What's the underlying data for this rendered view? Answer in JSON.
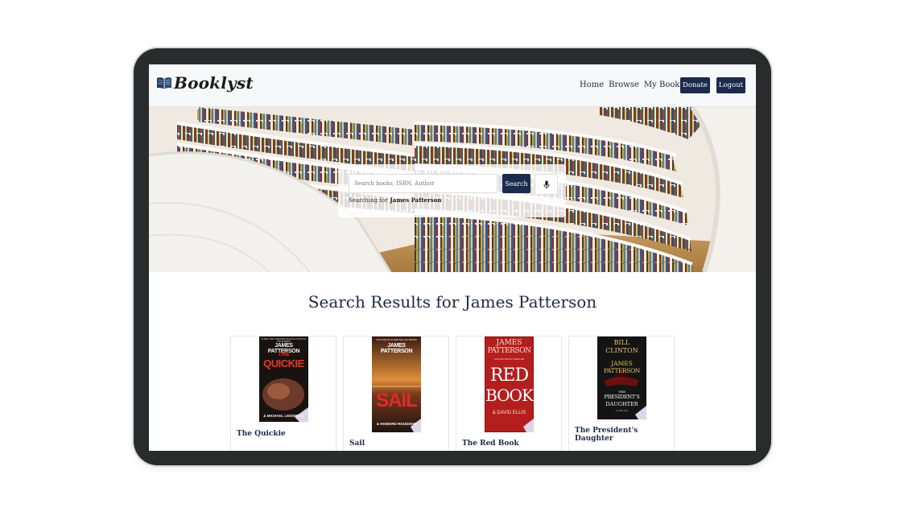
{
  "app": {
    "name": "Booklyst"
  },
  "nav": {
    "links": [
      "Home",
      "Browse",
      "My Books"
    ],
    "donate_label": "Donate",
    "logout_label": "Logout"
  },
  "search": {
    "placeholder": "Search books, ISBN, Author",
    "value": "",
    "button_label": "Search",
    "searching_prefix": "Searching for",
    "query": "James Patterson"
  },
  "results": {
    "heading": "Search Results for James Patterson",
    "books": [
      {
        "title": "The Quickie",
        "cover": {
          "top": "#1 NEW YORK TIMES BESTSELLING AUTHOR OF THE WOMEN'S",
          "author": "JAMES PATTERSON",
          "title_line1": "THE",
          "title_line2": "QUICKIE",
          "coauthor": "& MICHAEL LEDWIDGE"
        }
      },
      {
        "title": "Sail",
        "cover": {
          "top": "THE WORLD'S #1 BESTSELLING WRITER",
          "author": "JAMES PATTERSON",
          "title_line1": "SAIL",
          "coauthor": "& HOWARD ROUGHAN"
        }
      },
      {
        "title": "The Red Book",
        "cover": {
          "author_line1": "JAMES",
          "author_line2": "PATTERSON",
          "series": "A BLACK BOOK THRILLER",
          "title_line1": "RED",
          "title_line2": "BOOK",
          "coauthor": "& DAVID ELLIS"
        }
      },
      {
        "title": "The President's Daughter",
        "cover": {
          "author_line1": "BILL",
          "author_line2": "CLINTON",
          "author_line3": "JAMES",
          "author_line4": "PATTERSON",
          "title_line1": "THE",
          "title_line2": "PRESIDENT'S",
          "title_line3": "DAUGHTER",
          "bottom": "A THRILLER"
        }
      }
    ]
  },
  "colors": {
    "primary": "#1b2b4d",
    "heading": "#1e2a44",
    "frame": "#2a2b2c",
    "navbar_bg": "#f7f8f9"
  },
  "icons": {
    "logo": "open-book-icon",
    "mic": "microphone-icon"
  }
}
